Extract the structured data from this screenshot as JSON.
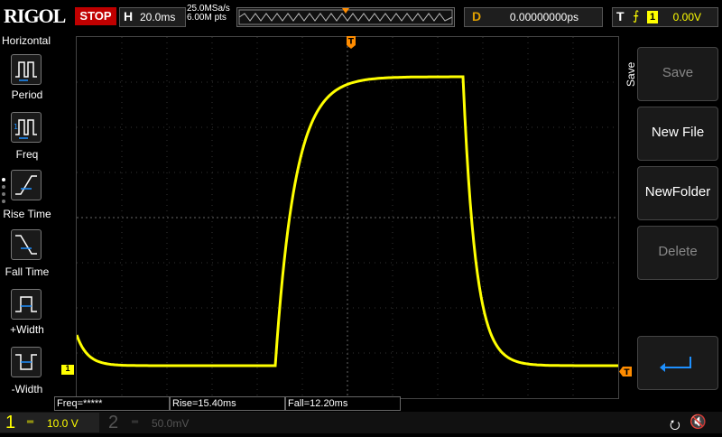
{
  "header": {
    "brand": "RIGOL",
    "run_state": "STOP",
    "horizontal_key": "H",
    "timebase": "20.0ms",
    "sample_rate": "25.0MSa/s",
    "memory_depth": "6.00M pts",
    "delay_key": "D",
    "delay": "0.00000000ps",
    "trigger_key": "T",
    "trigger_source": "1",
    "trigger_level": "0.00V"
  },
  "left_menu": {
    "title": "Horizontal",
    "items": [
      {
        "label": "Period",
        "icon": "period-icon"
      },
      {
        "label": "Freq",
        "icon": "frequency-icon"
      },
      {
        "label": "Rise Time",
        "icon": "rise-time-icon"
      },
      {
        "label": "Fall Time",
        "icon": "fall-time-icon"
      },
      {
        "label": "+Width",
        "icon": "positive-width-icon"
      },
      {
        "label": "-Width",
        "icon": "negative-width-icon"
      }
    ]
  },
  "right_menu": {
    "title": "Save",
    "buttons": [
      {
        "label": "Save",
        "enabled": false
      },
      {
        "label": "New File",
        "enabled": true
      },
      {
        "label": "NewFolder",
        "enabled": true
      },
      {
        "label": "Delete",
        "enabled": false
      }
    ],
    "return_icon": "return-arrow-icon"
  },
  "waveform": {
    "channel_marker": "1",
    "trigger_marker": "T",
    "color": "#ffff00"
  },
  "measurements": {
    "freq": "Freq=*****",
    "rise": "Rise=15.40ms",
    "fall": "Fall=12.20ms"
  },
  "footer": {
    "ch1_number": "1",
    "ch1_scale": "10.0 V",
    "ch2_number": "2",
    "ch2_scale": "50.0mV",
    "status_icons": [
      "usb-icon",
      "speaker-muted-icon"
    ]
  }
}
